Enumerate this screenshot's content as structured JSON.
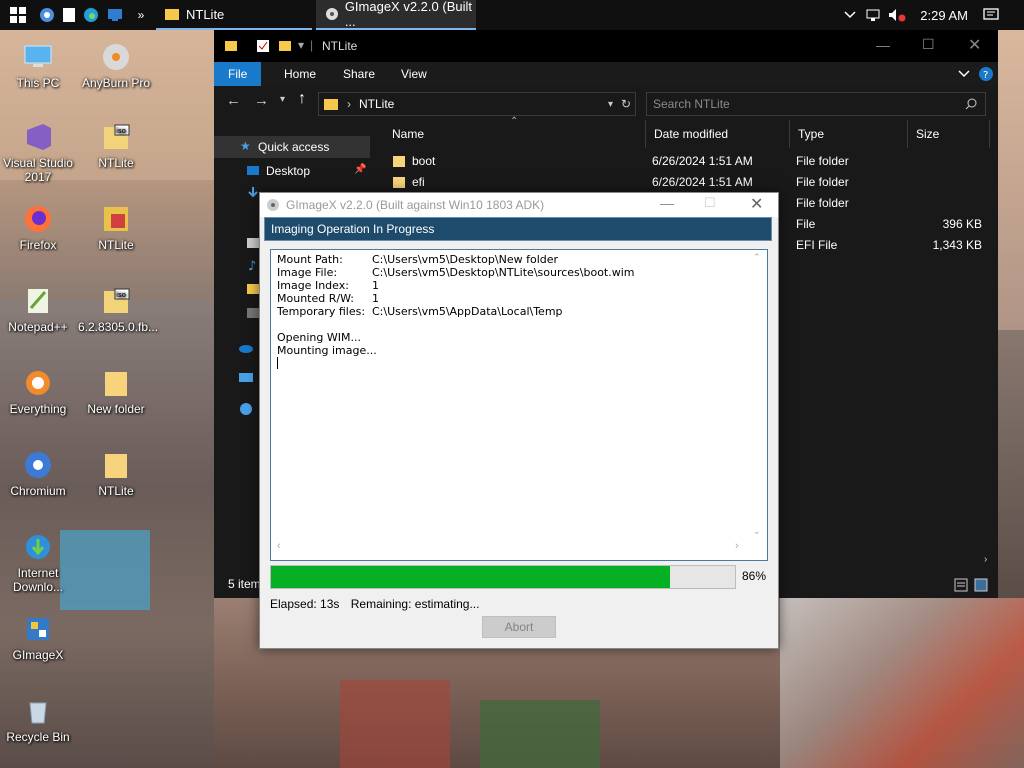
{
  "taskbar": {
    "apps": [
      {
        "label": "NTLite"
      },
      {
        "label": "GImageX v2.2.0 (Built ..."
      }
    ],
    "time": "2:29 AM"
  },
  "desktop": {
    "icons": [
      {
        "label": "This PC",
        "icon": "this-pc-icon"
      },
      {
        "label": "AnyBurn Pro",
        "icon": "anyburn-icon"
      },
      {
        "label": "Visual Studio 2017",
        "icon": "visual-studio-icon"
      },
      {
        "label": "NTLite",
        "icon": "iso-file-icon"
      },
      {
        "label": "Firefox",
        "icon": "firefox-icon"
      },
      {
        "label": "NTLite",
        "icon": "ntlite-icon"
      },
      {
        "label": "Notepad++",
        "icon": "notepad-plus-plus-icon"
      },
      {
        "label": "6.2.8305.0.fb...",
        "icon": "iso-file-icon"
      },
      {
        "label": "Everything",
        "icon": "everything-icon"
      },
      {
        "label": "New folder",
        "icon": "folder-icon"
      },
      {
        "label": "Chromium",
        "icon": "chromium-icon"
      },
      {
        "label": "NTLite",
        "icon": "folder-icon"
      },
      {
        "label": "Internet Downlo...",
        "icon": "internet-download-icon"
      },
      {
        "label": "GImageX",
        "icon": "gimagex-icon"
      },
      {
        "label": "Recycle Bin",
        "icon": "recycle-bin-icon"
      }
    ]
  },
  "explorer": {
    "title": "NTLite",
    "ribbon": {
      "file": "File",
      "home": "Home",
      "share": "Share",
      "view": "View"
    },
    "address": "NTLite",
    "search_placeholder": "Search NTLite",
    "nav": {
      "quick_access": "Quick access",
      "desktop": "Desktop"
    },
    "columns": {
      "name": "Name",
      "date": "Date modified",
      "type": "Type",
      "size": "Size"
    },
    "files": [
      {
        "name": "boot",
        "date": "6/26/2024 1:51 AM",
        "type": "File folder",
        "size": ""
      },
      {
        "name": "efi",
        "date": "6/26/2024 1:51 AM",
        "type": "File folder",
        "size": ""
      },
      {
        "name": "",
        "date": "",
        "type": "File folder",
        "size": ""
      },
      {
        "name": "",
        "date": "",
        "type": "File",
        "size": "396 KB"
      },
      {
        "name": "",
        "date": "",
        "type": "EFI File",
        "size": "1,343 KB"
      }
    ],
    "status": "5 item"
  },
  "dialog": {
    "title": "GImageX v2.2.0 (Built against Win10 1803 ADK)",
    "heading": "Imaging Operation In Progress",
    "log": [
      {
        "key": "Mount Path:",
        "value": "C:\\Users\\vm5\\Desktop\\New folder"
      },
      {
        "key": "Image File:",
        "value": "C:\\Users\\vm5\\Desktop\\NTLite\\sources\\boot.wim"
      },
      {
        "key": "Image Index:",
        "value": "1"
      },
      {
        "key": "Mounted R/W:",
        "value": "1"
      },
      {
        "key": "Temporary files:",
        "value": "C:\\Users\\vm5\\AppData\\Local\\Temp"
      }
    ],
    "messages": [
      "Opening WIM...",
      "Mounting image..."
    ],
    "progress_fraction": 0.86,
    "progress_label": "86%",
    "elapsed": "Elapsed: 13s",
    "remaining": "Remaining: estimating...",
    "abort_label": "Abort"
  },
  "colors": {
    "progress": "#06b025",
    "explorer_accent": "#1979ca",
    "dialog_header": "#1e4a6c"
  }
}
